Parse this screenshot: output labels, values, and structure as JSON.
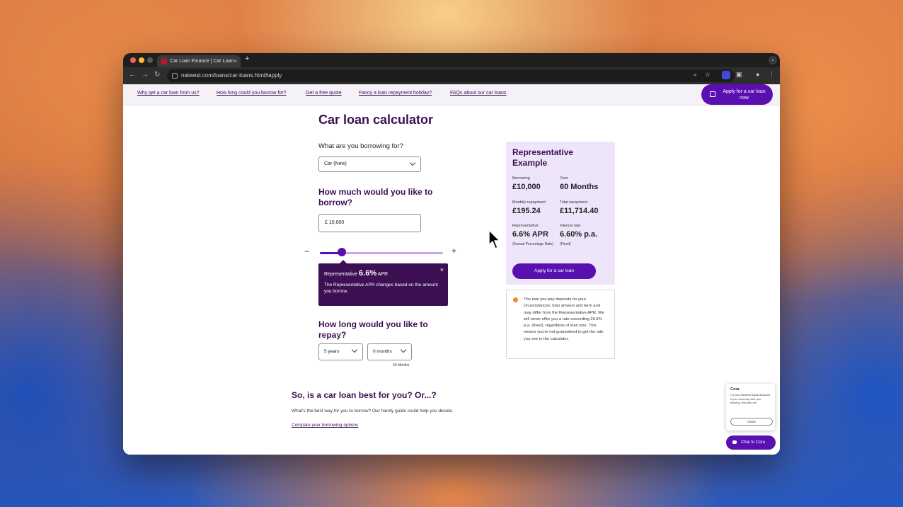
{
  "browser": {
    "tab_title": "Car Loan Finance | Car Loan",
    "tab_close": "×",
    "new_tab": "+",
    "tab_menu": "⌄",
    "url": "natwest.com/loans/car-loans.html#apply",
    "nav_back": "←",
    "nav_forward": "→",
    "nav_reload": "↻",
    "icon_zoom": "⌕",
    "icon_star": "☆",
    "icon_profile": "●",
    "icon_menu": "⋮"
  },
  "subnav": {
    "links": [
      "Why get a car loan from us?",
      "How long could you borrow for?",
      "Get a free quote",
      "Fancy a loan repayment holiday?",
      "FAQs about our car loans"
    ],
    "apply_button": "Apply for a car loan now"
  },
  "calculator": {
    "title": "Car loan calculator",
    "purpose_question": "What are you borrowing for?",
    "purpose_value": "Car (New)",
    "amount_heading": "How much would you like to borrow?",
    "amount_value": "£ 10,000",
    "minus": "−",
    "plus": "+",
    "slider_fraction": 0.18,
    "tooltip": {
      "prefix": "Representative",
      "apr": "6.6%",
      "suffix": "APR",
      "text": "The Representative APR changes based on the amount you borrow.",
      "close": "×"
    },
    "term_heading": "How long would you like to repay?",
    "years_value": "5 years",
    "months_value": "0 months",
    "months_note": "60 Months"
  },
  "rep_example": {
    "title": "Representative Example",
    "borrowing_label": "Borrowing",
    "borrowing_value": "£10,000",
    "over_label": "Over",
    "over_value": "60 Months",
    "monthly_label": "Monthly repayment",
    "monthly_value": "£195.24",
    "total_label": "Total repayment",
    "total_value": "£11,714.40",
    "rep_label": "Representative",
    "rep_value": "6.6% APR",
    "rep_note": "(Annual Percentage Rate)",
    "rate_label": "Interest rate",
    "rate_value": "6.60% p.a.",
    "rate_note": "(Fixed)",
    "apply_button": "Apply for a car loan"
  },
  "info": {
    "text": "The rate you pay depends on your circumstances, loan amount and term and may differ from the Representative APR. We will never offer you a rate exceeding 29.9% p.a. (fixed), regardless of loan size. This means you're not guaranteed to get the rate you see in the calculator."
  },
  "bottom": {
    "title": "So, is a car loan best for you? Or...?",
    "text": "What's the best way for you to borrow?  Our handy guide could help you decide.",
    "link": "Compare your borrowing options"
  },
  "cora": {
    "title": "Cora",
    "message": "I'm your NatWest digital assistant. If you need help with your banking, chat with me.",
    "close_button": "Close",
    "chat_button": "Chat to Cora"
  },
  "colors": {
    "brand_purple": "#3c1053",
    "accent_violet": "#5a0fb0",
    "card_lilac": "#efe5fb",
    "info_orange": "#f28b22"
  }
}
